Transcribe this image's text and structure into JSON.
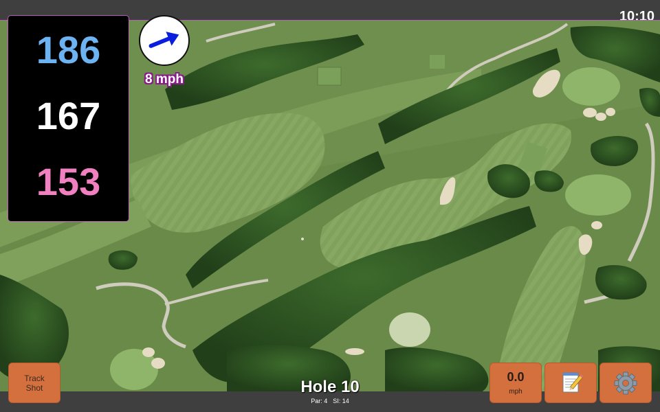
{
  "status_bar": {
    "time": "10:10"
  },
  "distances": {
    "back": {
      "value": "186",
      "color": "#6db3f2"
    },
    "middle": {
      "value": "167",
      "color": "#ffffff"
    },
    "front": {
      "value": "153",
      "color": "#f080c0"
    }
  },
  "wind": {
    "speed_label": "8 mph",
    "direction_icon": "wind-direction-arrow-icon",
    "arrow_color": "#0a1fdc"
  },
  "hole": {
    "title": "Hole 10",
    "par": "Par: 4",
    "stroke_index": "SI: 14"
  },
  "buttons": {
    "track_shot": {
      "line1": "Track",
      "line2": "Shot"
    },
    "wind_unit": {
      "value": "0.0",
      "unit": "mph"
    },
    "notes": {
      "icon": "notepad-icon"
    },
    "settings": {
      "icon": "gear-icon"
    }
  },
  "colors": {
    "button_bg": "#d4703d",
    "panel_border": "#b55fb5",
    "bar_bg": "#3f3f3f"
  }
}
